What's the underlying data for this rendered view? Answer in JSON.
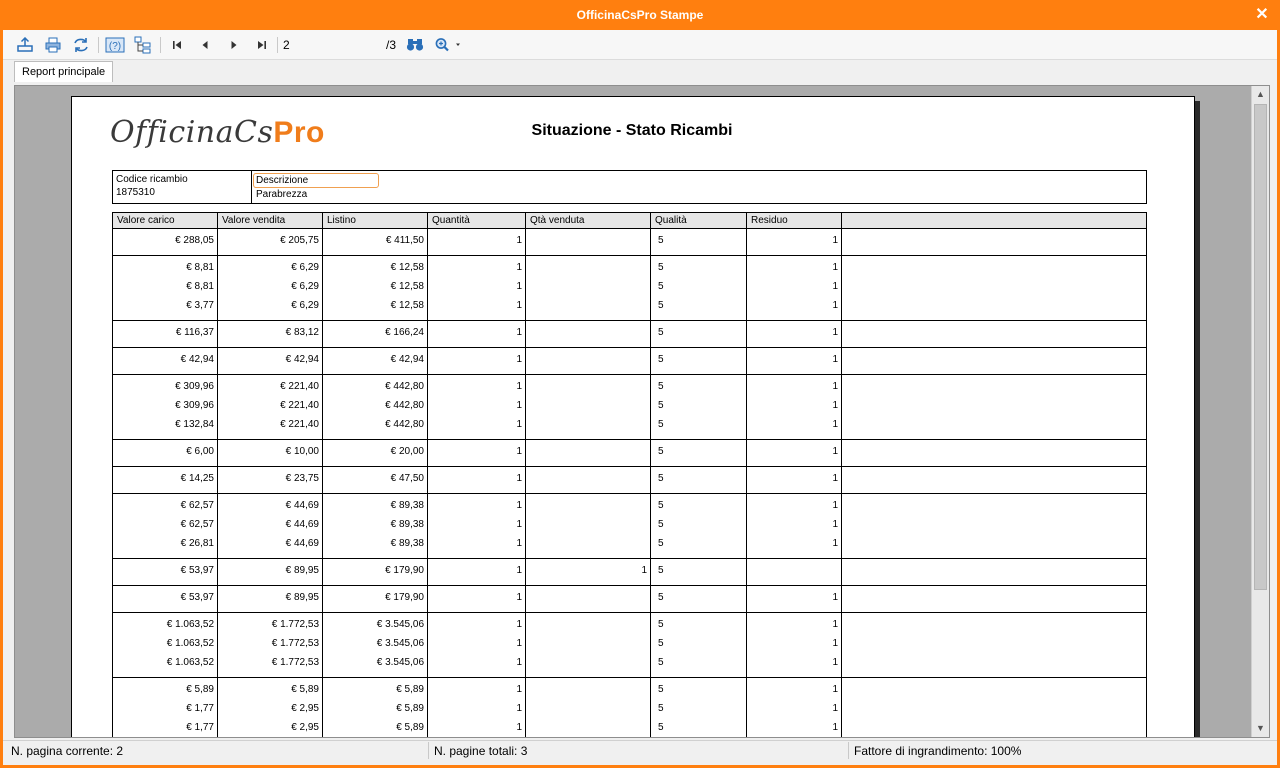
{
  "window": {
    "title": "OfficinaCsPro Stampe",
    "close_glyph": "✕"
  },
  "toolbar": {
    "buttons": [
      "export-icon",
      "print-icon",
      "refresh-icon",
      "help-icon",
      "tree-icon",
      "first-page-icon",
      "prev-page-icon",
      "next-page-icon",
      "last-page-icon",
      "find-icon",
      "zoom-icon"
    ],
    "current_page": "2",
    "total_pages": "/3"
  },
  "tabs": [
    {
      "label": "Report principale"
    }
  ],
  "report": {
    "logo_script": "OfficinaCs",
    "logo_pro": "Pro",
    "title": "Situazione - Stato Ricambi",
    "header": {
      "code_label": "Codice ricambio",
      "code_value": "1875310",
      "desc_label": "Descrizione",
      "desc_value": "Parabrezza"
    },
    "columns": [
      "Valore carico",
      "Valore vendita",
      "Listino",
      "Quantità",
      "Qtà venduta",
      "Qualità",
      "Residuo"
    ],
    "groups": [
      [
        [
          "€ 288,05",
          "€ 205,75",
          "€ 411,50",
          "1",
          "",
          "5",
          "1"
        ]
      ],
      [
        [
          "€ 8,81",
          "€ 6,29",
          "€ 12,58",
          "1",
          "",
          "5",
          "1"
        ],
        [
          "€ 8,81",
          "€ 6,29",
          "€ 12,58",
          "1",
          "",
          "5",
          "1"
        ],
        [
          "€ 3,77",
          "€ 6,29",
          "€ 12,58",
          "1",
          "",
          "5",
          "1"
        ]
      ],
      [
        [
          "€ 116,37",
          "€ 83,12",
          "€ 166,24",
          "1",
          "",
          "5",
          "1"
        ]
      ],
      [
        [
          "€ 42,94",
          "€ 42,94",
          "€ 42,94",
          "1",
          "",
          "5",
          "1"
        ]
      ],
      [
        [
          "€ 309,96",
          "€ 221,40",
          "€ 442,80",
          "1",
          "",
          "5",
          "1"
        ],
        [
          "€ 309,96",
          "€ 221,40",
          "€ 442,80",
          "1",
          "",
          "5",
          "1"
        ],
        [
          "€ 132,84",
          "€ 221,40",
          "€ 442,80",
          "1",
          "",
          "5",
          "1"
        ]
      ],
      [
        [
          "€ 6,00",
          "€ 10,00",
          "€ 20,00",
          "1",
          "",
          "5",
          "1"
        ]
      ],
      [
        [
          "€ 14,25",
          "€ 23,75",
          "€ 47,50",
          "1",
          "",
          "5",
          "1"
        ]
      ],
      [
        [
          "€ 62,57",
          "€ 44,69",
          "€ 89,38",
          "1",
          "",
          "5",
          "1"
        ],
        [
          "€ 62,57",
          "€ 44,69",
          "€ 89,38",
          "1",
          "",
          "5",
          "1"
        ],
        [
          "€ 26,81",
          "€ 44,69",
          "€ 89,38",
          "1",
          "",
          "5",
          "1"
        ]
      ],
      [
        [
          "€ 53,97",
          "€ 89,95",
          "€ 179,90",
          "1",
          "1",
          "5",
          ""
        ]
      ],
      [
        [
          "€ 53,97",
          "€ 89,95",
          "€ 179,90",
          "1",
          "",
          "5",
          "1"
        ]
      ],
      [
        [
          "€ 1.063,52",
          "€ 1.772,53",
          "€ 3.545,06",
          "1",
          "",
          "5",
          "1"
        ],
        [
          "€ 1.063,52",
          "€ 1.772,53",
          "€ 3.545,06",
          "1",
          "",
          "5",
          "1"
        ],
        [
          "€ 1.063,52",
          "€ 1.772,53",
          "€ 3.545,06",
          "1",
          "",
          "5",
          "1"
        ]
      ],
      [
        [
          "€ 5,89",
          "€ 5,89",
          "€ 5,89",
          "1",
          "",
          "5",
          "1"
        ],
        [
          "€ 1,77",
          "€ 2,95",
          "€ 5,89",
          "1",
          "",
          "5",
          "1"
        ],
        [
          "€ 1,77",
          "€ 2,95",
          "€ 5,89",
          "1",
          "",
          "5",
          "1"
        ]
      ]
    ]
  },
  "status": {
    "current_page": "N. pagina corrente: 2",
    "total_pages": "N. pagine totali: 3",
    "zoom": "Fattore di ingrandimento: 100%"
  },
  "colors": {
    "titlebar": "#ff7f0f",
    "logo_pro": "#f07d1b",
    "icon_blue": "#2a6fb8"
  }
}
